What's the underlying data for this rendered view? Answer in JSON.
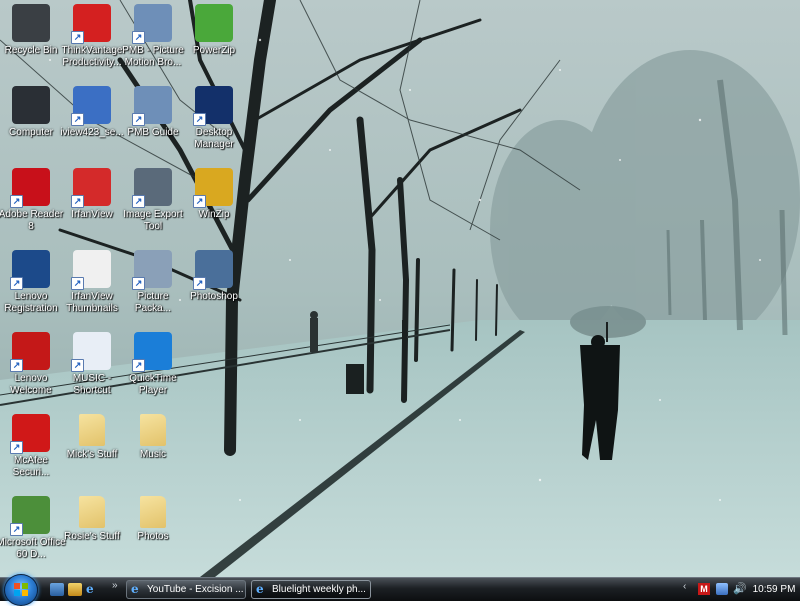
{
  "desktop": {
    "icons": [
      {
        "label": "Recycle Bin",
        "icon": "recycle-bin-icon",
        "color": "#3a3f44"
      },
      {
        "label": "ThinkVantage Productivity...",
        "icon": "thinkvantage-icon",
        "color": "#d42020"
      },
      {
        "label": "PMB - Picture Motion Bro...",
        "icon": "pmb-icon",
        "color": "#6e8fb8"
      },
      {
        "label": "PowerZip",
        "icon": "powerzip-icon",
        "color": "#4aa83a"
      },
      {
        "label": "Computer",
        "icon": "computer-icon",
        "color": "#2a2f35"
      },
      {
        "label": "iview423_se...",
        "icon": "installer-icon",
        "color": "#3b6fc4"
      },
      {
        "label": "PMB Guide",
        "icon": "pmb-guide-icon",
        "color": "#6e8fb8"
      },
      {
        "label": "Desktop Manager",
        "icon": "blackberry-icon",
        "color": "#13306a"
      },
      {
        "label": "Adobe Reader 8",
        "icon": "adobe-reader-icon",
        "color": "#c8101a"
      },
      {
        "label": "IrfanView",
        "icon": "irfanview-icon",
        "color": "#d42a2a"
      },
      {
        "label": "Image Export Tool",
        "icon": "camera-icon",
        "color": "#5a6a7a"
      },
      {
        "label": "WinZip",
        "icon": "winzip-icon",
        "color": "#d9a820"
      },
      {
        "label": "Lenovo Registration",
        "icon": "lenovo-icon",
        "color": "#1c4a8a"
      },
      {
        "label": "IrfanView Thumbnails",
        "icon": "panda-icon",
        "color": "#f0f0f0"
      },
      {
        "label": "Picture Packa...",
        "icon": "picture-package-icon",
        "color": "#8aa0b8"
      },
      {
        "label": "Photoshop",
        "icon": "photoshop-icon",
        "color": "#4a6f9a"
      },
      {
        "label": "Lenovo Welcome",
        "icon": "lenovo-welcome-icon",
        "color": "#c41818"
      },
      {
        "label": "MUSIC - Shortcut",
        "icon": "music-note-icon",
        "color": "#e8eef6"
      },
      {
        "label": "QuickTime Player",
        "icon": "quicktime-icon",
        "color": "#1b7ed8"
      },
      {
        "label": "McAfee Securi...",
        "icon": "mcafee-icon",
        "color": "#d01818"
      },
      {
        "label": "Mick's Stuff",
        "icon": "folder-icon",
        "color": "#e2c26a"
      },
      {
        "label": "Music",
        "icon": "folder-icon",
        "color": "#e2c26a"
      },
      {
        "label": "Microsoft Office 60 D...",
        "icon": "office-icon",
        "color": "#4c8f3a"
      },
      {
        "label": "Rosie's Stuff",
        "icon": "folder-icon",
        "color": "#e2c26a"
      },
      {
        "label": "Photos",
        "icon": "folder-icon",
        "color": "#e2c26a"
      }
    ]
  },
  "taskbar": {
    "quick_launch_more": "»",
    "tasks": [
      {
        "label": "YouTube - Excision ...",
        "icon": "internet-explorer-icon",
        "active": false
      },
      {
        "label": "Bluelight weekly ph...",
        "icon": "internet-explorer-icon",
        "active": true
      }
    ],
    "tray_expand": "‹",
    "clock": "10:59 PM"
  }
}
